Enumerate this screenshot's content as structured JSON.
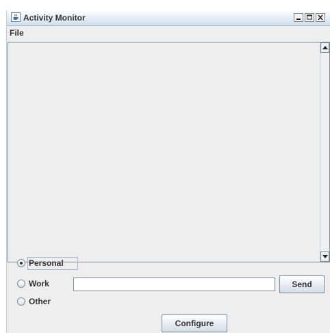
{
  "window": {
    "title": "Activity Monitor",
    "controls": [
      "minimize",
      "maximize",
      "close"
    ]
  },
  "menubar": {
    "items": [
      {
        "label": "File"
      }
    ]
  },
  "output_area": {
    "text": ""
  },
  "category": {
    "options": [
      {
        "label": "Personal",
        "selected": true
      },
      {
        "label": "Work",
        "selected": false
      },
      {
        "label": "Other",
        "selected": false
      }
    ]
  },
  "message_input": {
    "value": "",
    "placeholder": ""
  },
  "buttons": {
    "send": "Send",
    "configure": "Configure"
  },
  "icons": {
    "app": "java-cup-icon",
    "minimize": "minimize-icon",
    "maximize": "maximize-icon",
    "close": "close-icon",
    "scroll_up": "arrow-up-icon",
    "scroll_down": "arrow-down-icon"
  }
}
